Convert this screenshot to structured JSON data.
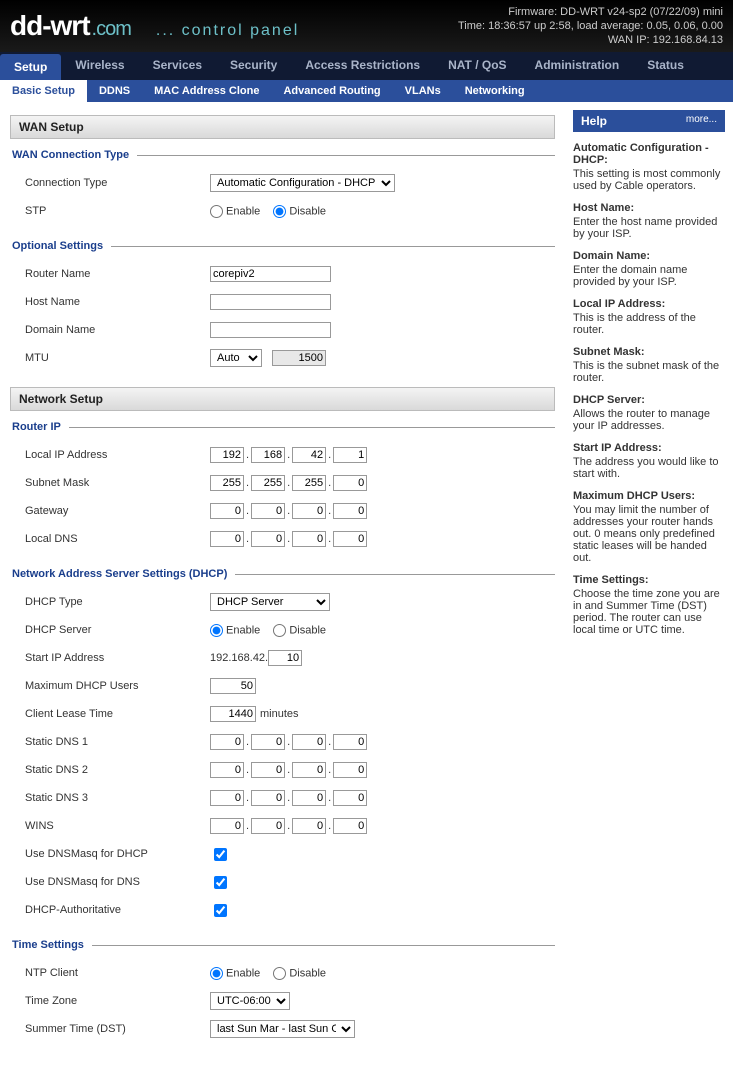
{
  "header": {
    "logo_main": "dd-wrt",
    "logo_com": ".com",
    "logo_cp": "... control panel",
    "firmware": "Firmware: DD-WRT v24-sp2 (07/22/09) mini",
    "time": "Time: 18:36:57 up 2:58, load average: 0.05, 0.06, 0.00",
    "wanip": "WAN IP: 192.168.84.13"
  },
  "tabs": [
    "Setup",
    "Wireless",
    "Services",
    "Security",
    "Access Restrictions",
    "NAT / QoS",
    "Administration",
    "Status"
  ],
  "tab_active": "Setup",
  "subtabs": [
    "Basic Setup",
    "DDNS",
    "MAC Address Clone",
    "Advanced Routing",
    "VLANs",
    "Networking"
  ],
  "subtab_active": "Basic Setup",
  "wan_setup_title": "WAN Setup",
  "wan_conn_legend": "WAN Connection Type",
  "conn_type_label": "Connection Type",
  "conn_type_value": "Automatic Configuration - DHCP",
  "stp_label": "STP",
  "enable": "Enable",
  "disable": "Disable",
  "stp_value": "Disable",
  "optional_legend": "Optional Settings",
  "router_name_label": "Router Name",
  "router_name": "corepiv2",
  "host_name_label": "Host Name",
  "host_name": "",
  "domain_name_label": "Domain Name",
  "domain_name": "",
  "mtu_label": "MTU",
  "mtu_mode": "Auto",
  "mtu_value": "1500",
  "network_setup_title": "Network Setup",
  "routerip_legend": "Router IP",
  "local_ip_label": "Local IP Address",
  "local_ip": [
    "192",
    "168",
    "42",
    "1"
  ],
  "subnet_label": "Subnet Mask",
  "subnet": [
    "255",
    "255",
    "255",
    "0"
  ],
  "gateway_label": "Gateway",
  "gateway": [
    "0",
    "0",
    "0",
    "0"
  ],
  "localdns_label": "Local DNS",
  "localdns": [
    "0",
    "0",
    "0",
    "0"
  ],
  "dhcp_legend": "Network Address Server Settings (DHCP)",
  "dhcp_type_label": "DHCP Type",
  "dhcp_type": "DHCP Server",
  "dhcp_server_label": "DHCP Server",
  "dhcp_server_value": "Enable",
  "start_ip_label": "Start IP Address",
  "start_ip_prefix": "192.168.42.",
  "start_ip_last": "10",
  "max_users_label": "Maximum DHCP Users",
  "max_users": "50",
  "lease_label": "Client Lease Time",
  "lease_value": "1440",
  "lease_unit": "minutes",
  "sdns1_label": "Static DNS 1",
  "sdns1": [
    "0",
    "0",
    "0",
    "0"
  ],
  "sdns2_label": "Static DNS 2",
  "sdns2": [
    "0",
    "0",
    "0",
    "0"
  ],
  "sdns3_label": "Static DNS 3",
  "sdns3": [
    "0",
    "0",
    "0",
    "0"
  ],
  "wins_label": "WINS",
  "wins": [
    "0",
    "0",
    "0",
    "0"
  ],
  "dnsmasq_dhcp_label": "Use DNSMasq for DHCP",
  "dnsmasq_dhcp": true,
  "dnsmasq_dns_label": "Use DNSMasq for DNS",
  "dnsmasq_dns": true,
  "dhcp_auth_label": "DHCP-Authoritative",
  "dhcp_auth": true,
  "time_legend": "Time Settings",
  "ntp_label": "NTP Client",
  "ntp_value": "Enable",
  "tz_label": "Time Zone",
  "tz_value": "UTC-06:00",
  "dst_label": "Summer Time (DST)",
  "dst_value": "last Sun Mar - last Sun Oct",
  "help": {
    "title": "Help",
    "more": "more...",
    "items": [
      {
        "t": "Automatic Configuration - DHCP:",
        "d": "This setting is most commonly used by Cable operators."
      },
      {
        "t": "Host Name:",
        "d": "Enter the host name provided by your ISP."
      },
      {
        "t": "Domain Name:",
        "d": "Enter the domain name provided by your ISP."
      },
      {
        "t": "Local IP Address:",
        "d": "This is the address of the router."
      },
      {
        "t": "Subnet Mask:",
        "d": "This is the subnet mask of the router."
      },
      {
        "t": "DHCP Server:",
        "d": "Allows the router to manage your IP addresses."
      },
      {
        "t": "Start IP Address:",
        "d": "The address you would like to start with."
      },
      {
        "t": "Maximum DHCP Users:",
        "d": "You may limit the number of addresses your router hands out. 0 means only predefined static leases will be handed out."
      },
      {
        "t": "Time Settings:",
        "d": "Choose the time zone you are in and Summer Time (DST) period. The router can use local time or UTC time."
      }
    ]
  }
}
